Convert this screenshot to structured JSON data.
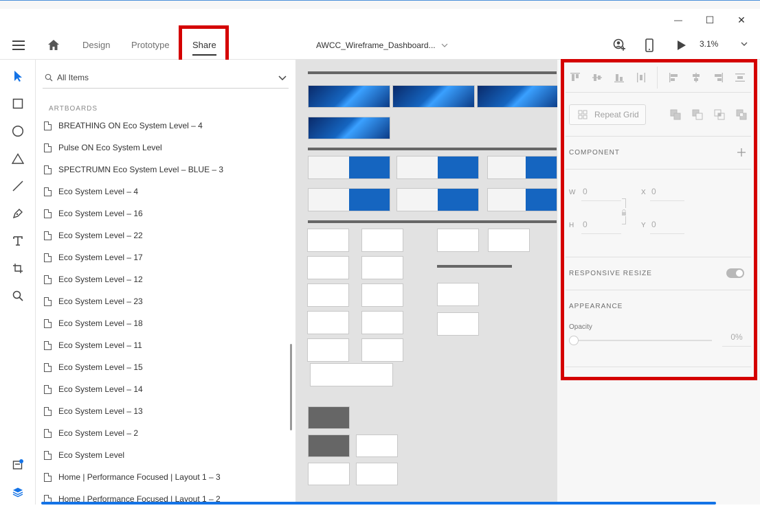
{
  "window": {
    "minimize_symbol": "—",
    "maximize_symbol": "☐",
    "close_symbol": "✕"
  },
  "appbar": {
    "tabs": [
      {
        "label": "Design"
      },
      {
        "label": "Prototype"
      },
      {
        "label": "Share"
      }
    ],
    "active_tab": "Share",
    "document_title": "AWCC_Wireframe_Dashboard...",
    "zoom": "3.1%"
  },
  "layers": {
    "filter_label": "All Items",
    "section_title": "ARTBOARDS",
    "items": [
      "BREATHING ON Eco System Level – 4",
      "Pulse ON Eco System Level",
      "SPECTRUMN Eco System Level – BLUE – 3",
      "Eco System Level – 4",
      "Eco System Level – 16",
      "Eco System Level – 22",
      "Eco System Level – 17",
      "Eco System Level – 12",
      "Eco System Level – 23",
      "Eco System Level – 18",
      "Eco System Level – 11",
      "Eco System Level – 15",
      "Eco System Level – 14",
      "Eco System Level – 13",
      "Eco System Level – 2",
      "Eco System Level",
      "Home | Performance Focused | Layout 1 – 3",
      "Home | Performance Focused | Layout 1 – 2"
    ]
  },
  "properties": {
    "repeat_grid_label": "Repeat Grid",
    "component_title": "COMPONENT",
    "w_label": "W",
    "w_value": "0",
    "x_label": "X",
    "x_value": "0",
    "h_label": "H",
    "h_value": "0",
    "y_label": "Y",
    "y_value": "0",
    "responsive_resize_title": "RESPONSIVE RESIZE",
    "responsive_resize_on": true,
    "appearance_title": "APPEARANCE",
    "opacity_label": "Opacity",
    "opacity_value": "0%"
  },
  "colors": {
    "highlight_red": "#d40000",
    "accent_blue": "#1473e6"
  }
}
